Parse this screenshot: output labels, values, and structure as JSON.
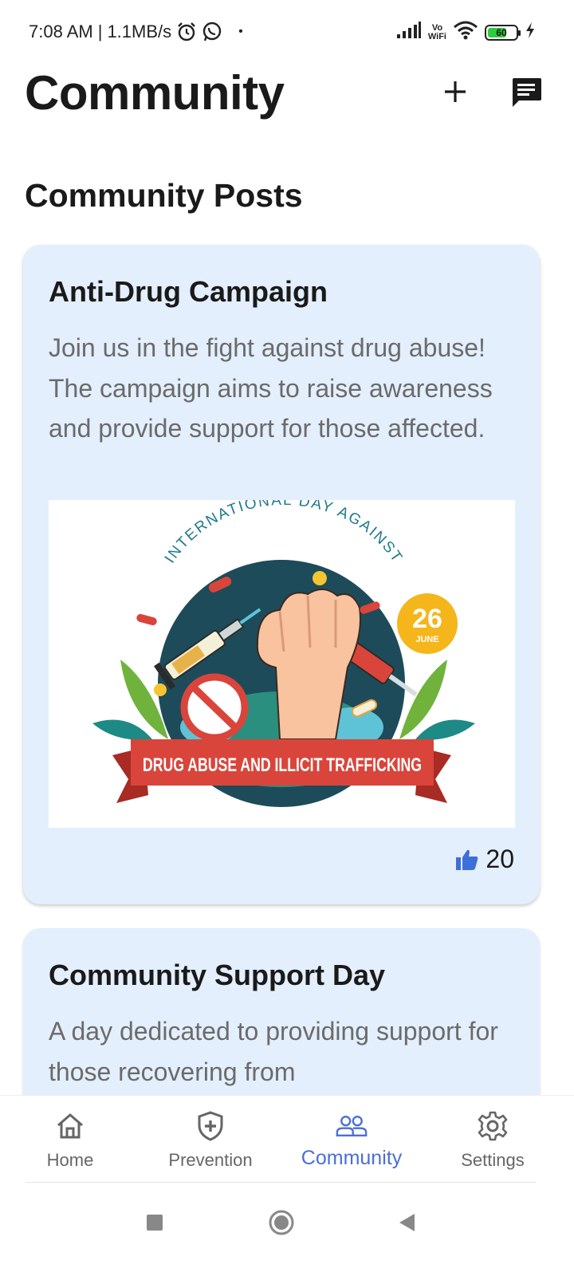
{
  "status_bar": {
    "time": "7:08 AM",
    "separator": "|",
    "speed": "1.1MB/s",
    "dot": "•",
    "vowifi_top": "Vo",
    "vowifi_bottom": "WiFi",
    "battery_level": "60",
    "icons": [
      "alarm-icon",
      "whatsapp-icon",
      "signal-icon",
      "wifi-icon",
      "battery-icon",
      "charging-icon"
    ]
  },
  "header": {
    "title": "Community",
    "add_icon": "plus-icon",
    "chat_icon": "chat-icon"
  },
  "section": {
    "title": "Community Posts"
  },
  "posts": [
    {
      "title": "Anti-Drug Campaign",
      "body": "Join us in the fight against drug abuse! The campaign aims to raise awareness and provide support for those affected.",
      "image": {
        "arc_text": "INTERNATIONAL DAY AGAINST",
        "date_day": "26",
        "date_month": "JUNE",
        "banner_text": "DRUG ABUSE AND ILLICIT TRAFFICKING"
      },
      "likes": "20"
    },
    {
      "title": "Community Support Day",
      "body": "A day dedicated to providing support for those recovering from"
    }
  ],
  "nav": {
    "items": [
      {
        "label": "Home",
        "icon": "home-icon"
      },
      {
        "label": "Prevention",
        "icon": "shield-icon"
      },
      {
        "label": "Community",
        "icon": "people-icon"
      },
      {
        "label": "Settings",
        "icon": "gear-icon"
      }
    ],
    "active": "Community"
  },
  "colors": {
    "accent": "#4a6fd6",
    "card_background": "#e3effc",
    "like_icon": "#3d6fd9"
  }
}
